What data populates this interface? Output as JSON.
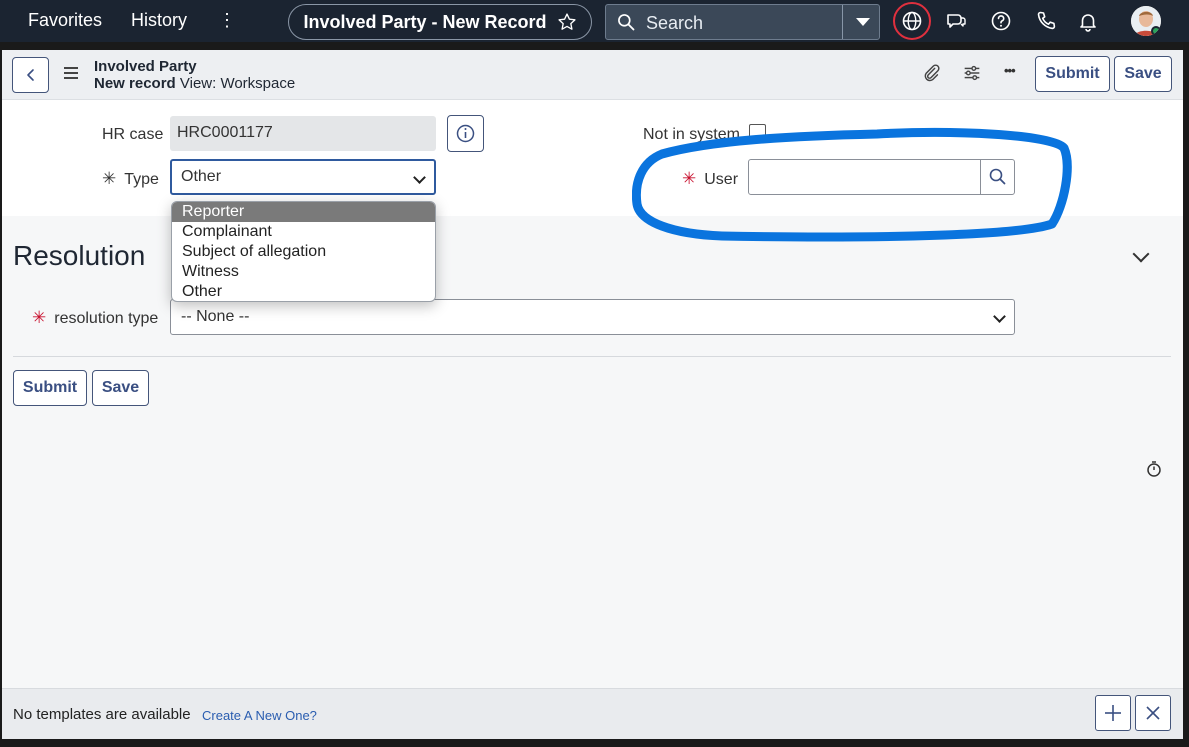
{
  "topnav": {
    "favorites": "Favorites",
    "history": "History",
    "more": "⋮",
    "record_pill": "Involved Party - New Record",
    "search_label": "Search"
  },
  "header": {
    "title": "Involved Party",
    "subtitle_bold": "New record",
    "subtitle_view": "View: Workspace",
    "submit_label": "Submit",
    "save_label": "Save",
    "more_label": "•••"
  },
  "form": {
    "hr_case_label": "HR case",
    "hr_case_value": "HRC0001177",
    "type_label": "Type",
    "type_value": "Other",
    "not_in_system_label": "Not in system",
    "user_label": "User",
    "user_value": "",
    "required_mark": "✳",
    "type_options": [
      "Reporter",
      "Complainant",
      "Subject of allegation",
      "Witness",
      "Other"
    ]
  },
  "resolution": {
    "title": "Resolution",
    "type_label": "resolution type",
    "type_value": "-- None --"
  },
  "actions": {
    "submit_label": "Submit",
    "save_label": "Save"
  },
  "footer": {
    "message": "No templates are available",
    "link": "Create A New One?"
  },
  "colors": {
    "nav_bg": "#1b2431",
    "accent": "#3a4f82",
    "required": "#c8102e",
    "annotation": "#0a74de"
  }
}
